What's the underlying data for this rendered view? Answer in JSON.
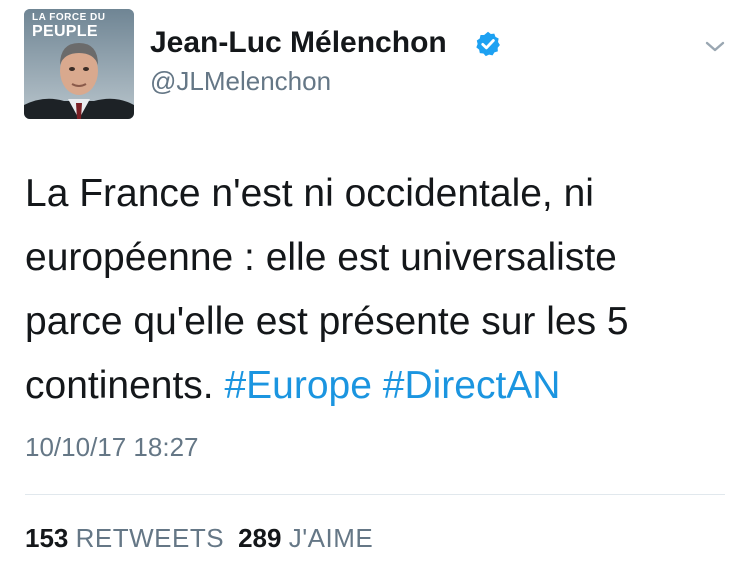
{
  "author": {
    "display_name": "Jean-Luc Mélenchon",
    "handle": "@JLMelenchon",
    "verified": true,
    "avatar_banner": {
      "line1": "LA FORCE DU",
      "line2": "PEUPLE"
    }
  },
  "tweet": {
    "text_plain": "La France n'est ni occidentale, ni européenne : elle est universaliste parce qu'elle est présente sur les 5 continents. ",
    "hashtag1": "#Europe",
    "hashtag2": "#DirectAN",
    "timestamp": "10/10/17 18:27"
  },
  "stats": {
    "retweets_count": "153",
    "retweets_label": "RETWEETS",
    "likes_count": "289",
    "likes_label": "J'AIME"
  },
  "colors": {
    "hashtag": "#1b95e0",
    "verified_badge": "#1da1f2",
    "secondary_text": "#657786",
    "divider": "#e1e8ed"
  },
  "icons": {
    "verified": "verified-badge-icon",
    "menu": "chevron-down-icon"
  }
}
